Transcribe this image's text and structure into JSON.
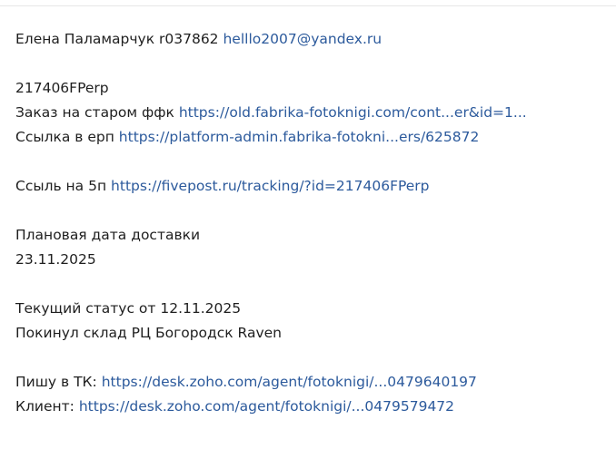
{
  "message": {
    "contact_name": "Елена Паламарчук r037862",
    "contact_email": "helllo2007@yandex.ru",
    "order_id": "217406FPerp",
    "old_order_label": "Заказ на старом ффк",
    "old_order_link": "https://old.fabrika-fotoknigi.com/cont...er&id=1...",
    "erp_label": "Ссылка в ерп",
    "erp_link": "https://platform-admin.fabrika-fotokni...ers/625872",
    "fivepost_label": "Ссыль на 5п",
    "fivepost_link": "https://fivepost.ru/tracking/?id=217406FPerp",
    "planned_date_label": "Плановая дата доставки",
    "planned_date_value": "23.11.2025",
    "status_label": "Текущий статус от 12.11.2025",
    "status_value": "Покинул склад РЦ Богородск Raven",
    "tk_label": "Пишу в ТК:",
    "tk_link": "https://desk.zoho.com/agent/fotoknigi/...0479640197",
    "client_label": "Клиент:",
    "client_link": "https://desk.zoho.com/agent/fotoknigi/...0479579472"
  },
  "colors": {
    "link": "#2c5a9c",
    "text": "#1f1f1f"
  }
}
